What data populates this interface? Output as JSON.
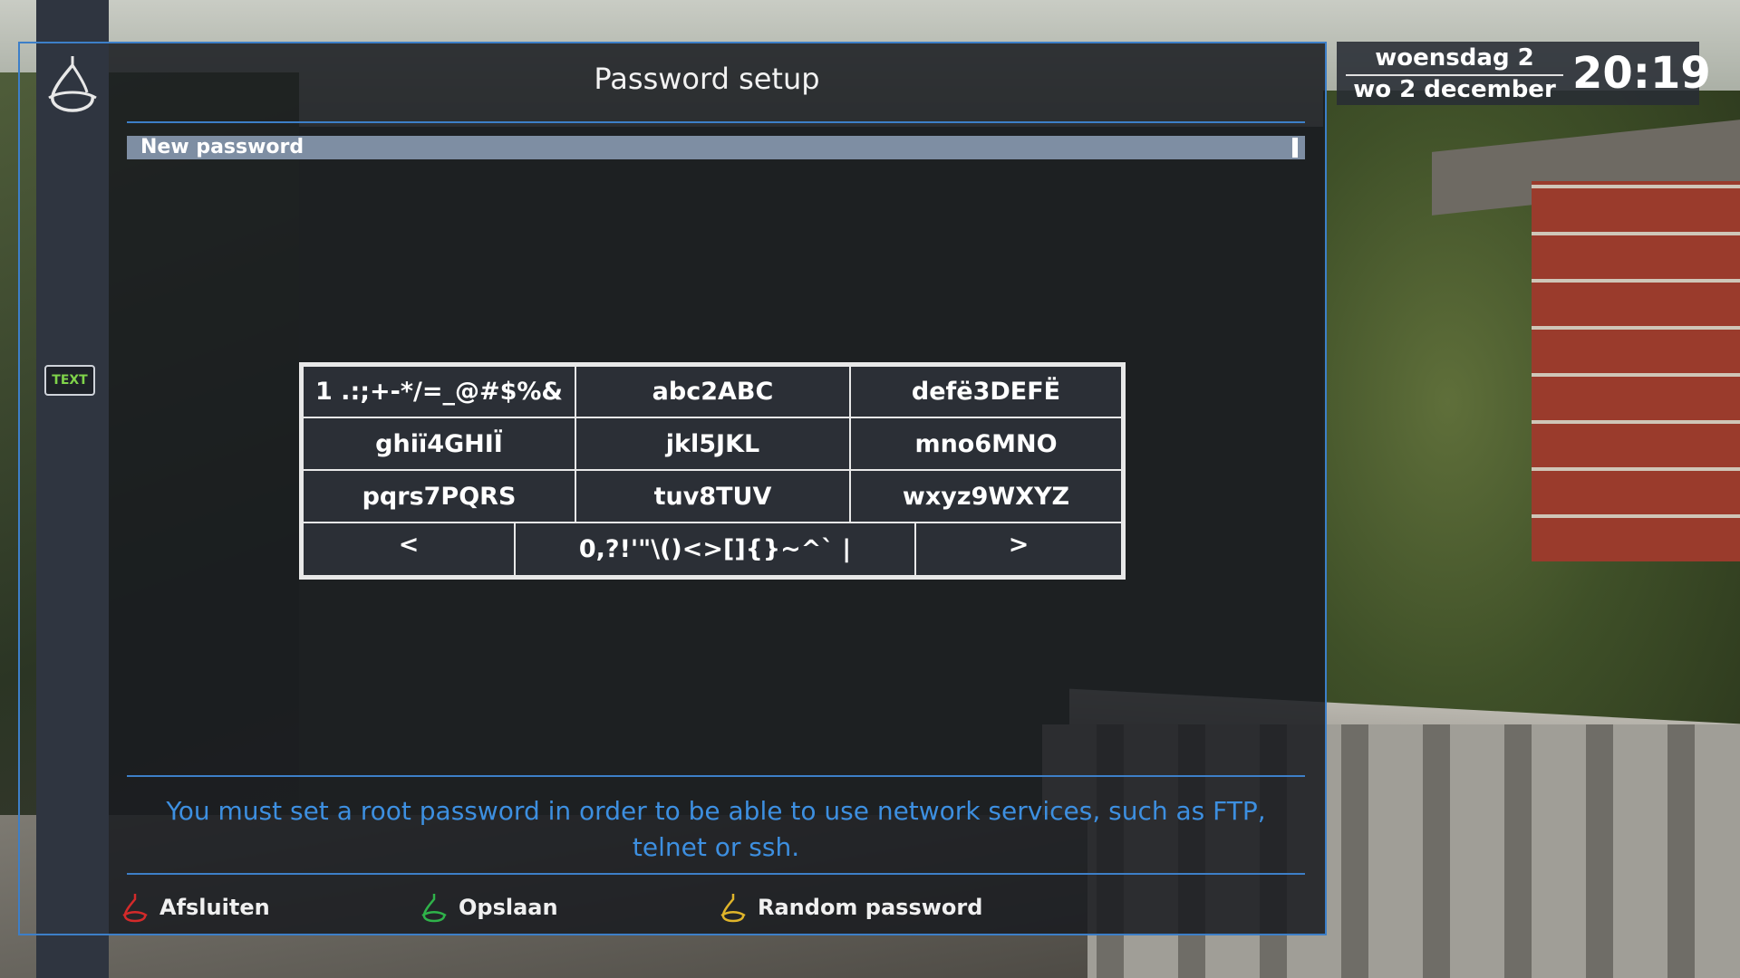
{
  "dialog": {
    "title": "Password setup",
    "input_label": "New password",
    "help_text": "You must set a root password in order to be able to use network services, such as FTP, telnet or ssh."
  },
  "keyboard": {
    "rows": [
      [
        "1 .:;+-*/=_@#$%&",
        "abc2ABC",
        "defë3DEFË"
      ],
      [
        "ghiï4GHIÏ",
        "jkl5JKL",
        "mno6MNO"
      ],
      [
        "pqrs7PQRS",
        "tuv8TUV",
        "wxyz9WXYZ"
      ]
    ],
    "bottom": {
      "left": "<",
      "middle": "0,?!'\"\\()<>[]{}~^` |",
      "right": ">"
    }
  },
  "sidebar": {
    "text_badge": "TEXT"
  },
  "buttons": {
    "red": {
      "label": "Afsluiten",
      "color": "#d42a2a"
    },
    "green": {
      "label": "Opslaan",
      "color": "#2fb34a"
    },
    "yellow": {
      "label": "Random password",
      "color": "#e0b52a"
    }
  },
  "clock": {
    "day_line": "woensdag 2",
    "date_line": "wo 2 december",
    "time": "20:19"
  },
  "colors": {
    "accent": "#3d7fc8",
    "help_text": "#3d8fe0",
    "input_bar": "#7e8ea3"
  },
  "icons": {
    "logo": "openatv-logo-icon",
    "legend": "button-logo-icon"
  }
}
